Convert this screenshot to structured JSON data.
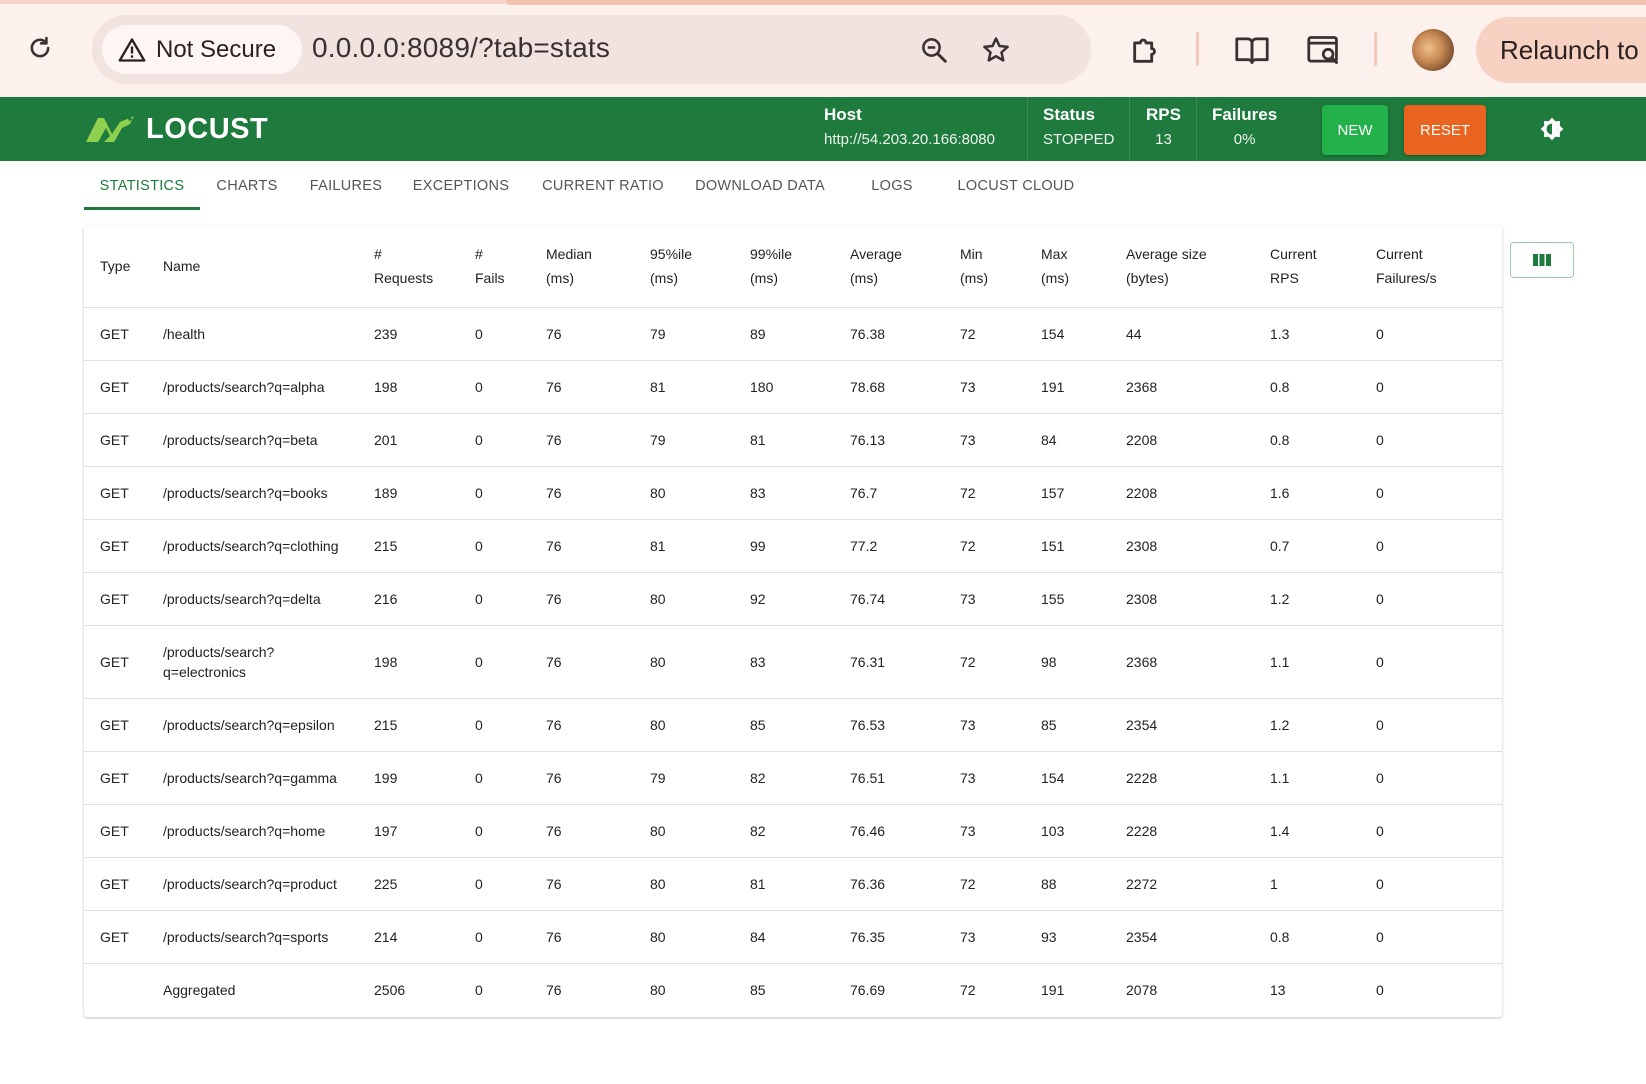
{
  "browser": {
    "security_label": "Not Secure",
    "url": "0.0.0.0:8089/?tab=stats",
    "relaunch_label": "Relaunch to"
  },
  "header": {
    "logo_text": "LOCUST",
    "host_label": "Host",
    "host_value": "http://54.203.20.166:8080",
    "status_label": "Status",
    "status_value": "STOPPED",
    "rps_label": "RPS",
    "rps_value": "13",
    "failures_label": "Failures",
    "failures_value": "0%",
    "new_button": "NEW",
    "reset_button": "RESET",
    "brand_color": "#1f7a3d"
  },
  "tabs": [
    {
      "label": "STATISTICS",
      "active": true
    },
    {
      "label": "CHARTS"
    },
    {
      "label": "FAILURES"
    },
    {
      "label": "EXCEPTIONS"
    },
    {
      "label": "CURRENT RATIO"
    },
    {
      "label": "DOWNLOAD DATA"
    },
    {
      "label": "LOGS"
    },
    {
      "label": "LOCUST CLOUD"
    }
  ],
  "table": {
    "columns": [
      {
        "line1": "Type",
        "line2": ""
      },
      {
        "line1": "Name",
        "line2": ""
      },
      {
        "line1": "#",
        "line2": "Requests"
      },
      {
        "line1": "#",
        "line2": "Fails"
      },
      {
        "line1": "Median",
        "line2": "(ms)"
      },
      {
        "line1": "95%ile",
        "line2": "(ms)"
      },
      {
        "line1": "99%ile",
        "line2": "(ms)"
      },
      {
        "line1": "Average",
        "line2": "(ms)"
      },
      {
        "line1": "Min",
        "line2": "(ms)"
      },
      {
        "line1": "Max",
        "line2": "(ms)"
      },
      {
        "line1": "Average size",
        "line2": "(bytes)"
      },
      {
        "line1": "Current",
        "line2": "RPS"
      },
      {
        "line1": "Current",
        "line2": "Failures/s"
      }
    ],
    "rows": [
      [
        "GET",
        "/health",
        "239",
        "0",
        "76",
        "79",
        "89",
        "76.38",
        "72",
        "154",
        "44",
        "1.3",
        "0"
      ],
      [
        "GET",
        "/products/search?q=alpha",
        "198",
        "0",
        "76",
        "81",
        "180",
        "78.68",
        "73",
        "191",
        "2368",
        "0.8",
        "0"
      ],
      [
        "GET",
        "/products/search?q=beta",
        "201",
        "0",
        "76",
        "79",
        "81",
        "76.13",
        "73",
        "84",
        "2208",
        "0.8",
        "0"
      ],
      [
        "GET",
        "/products/search?q=books",
        "189",
        "0",
        "76",
        "80",
        "83",
        "76.7",
        "72",
        "157",
        "2208",
        "1.6",
        "0"
      ],
      [
        "GET",
        "/products/search?q=clothing",
        "215",
        "0",
        "76",
        "81",
        "99",
        "77.2",
        "72",
        "151",
        "2308",
        "0.7",
        "0"
      ],
      [
        "GET",
        "/products/search?q=delta",
        "216",
        "0",
        "76",
        "80",
        "92",
        "76.74",
        "73",
        "155",
        "2308",
        "1.2",
        "0"
      ],
      [
        "GET",
        "/products/search? q=electronics",
        "198",
        "0",
        "76",
        "80",
        "83",
        "76.31",
        "72",
        "98",
        "2368",
        "1.1",
        "0"
      ],
      [
        "GET",
        "/products/search?q=epsilon",
        "215",
        "0",
        "76",
        "80",
        "85",
        "76.53",
        "73",
        "85",
        "2354",
        "1.2",
        "0"
      ],
      [
        "GET",
        "/products/search?q=gamma",
        "199",
        "0",
        "76",
        "79",
        "82",
        "76.51",
        "73",
        "154",
        "2228",
        "1.1",
        "0"
      ],
      [
        "GET",
        "/products/search?q=home",
        "197",
        "0",
        "76",
        "80",
        "82",
        "76.46",
        "73",
        "103",
        "2228",
        "1.4",
        "0"
      ],
      [
        "GET",
        "/products/search?q=product",
        "225",
        "0",
        "76",
        "80",
        "81",
        "76.36",
        "72",
        "88",
        "2272",
        "1",
        "0"
      ],
      [
        "GET",
        "/products/search?q=sports",
        "214",
        "0",
        "76",
        "80",
        "84",
        "76.35",
        "73",
        "93",
        "2354",
        "0.8",
        "0"
      ],
      [
        "",
        "Aggregated",
        "2506",
        "0",
        "76",
        "80",
        "85",
        "76.69",
        "72",
        "191",
        "2078",
        "13",
        "0"
      ]
    ]
  }
}
